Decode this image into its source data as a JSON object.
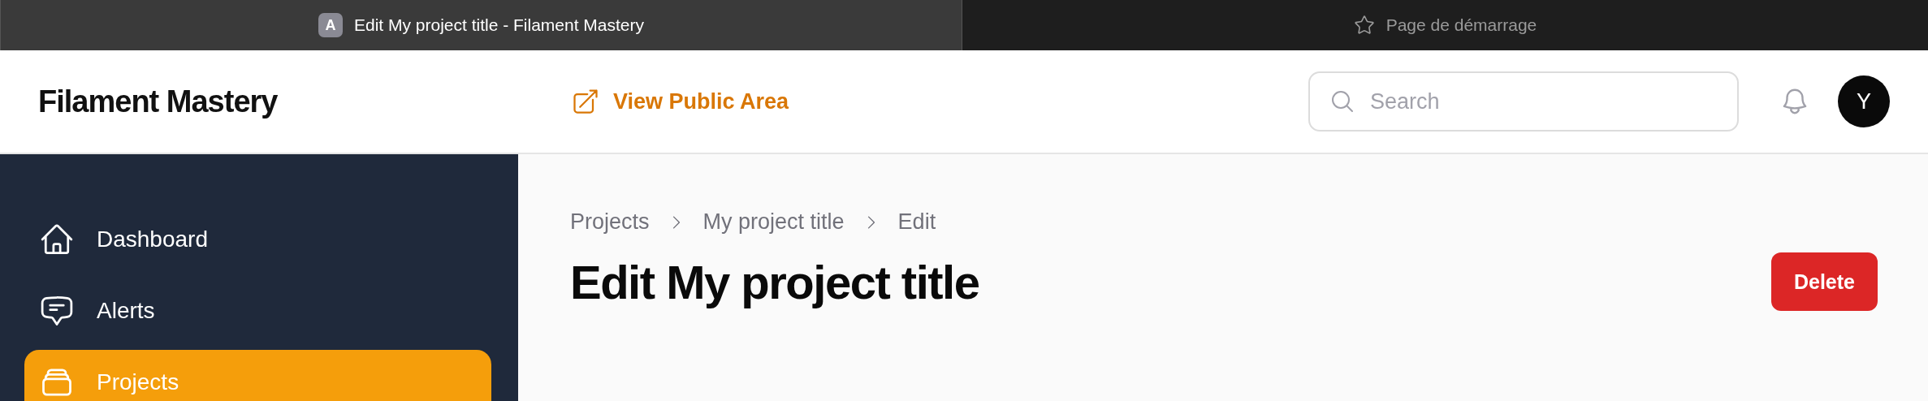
{
  "browser_tabs": [
    {
      "title": "Edit My project title - Filament Mastery",
      "favicon": "A",
      "selected": true
    },
    {
      "title": "Page de démarrage",
      "selected": false
    }
  ],
  "header": {
    "brand": "Filament Mastery",
    "public_link": "View Public Area",
    "search": {
      "placeholder": "Search"
    },
    "avatar": "Y"
  },
  "sidebar": {
    "items": [
      {
        "label": "Dashboard",
        "kind": "home",
        "selected": false
      },
      {
        "label": "Alerts",
        "kind": "chat",
        "selected": false
      },
      {
        "label": "Projects",
        "kind": "stack",
        "selected": true
      }
    ]
  },
  "breadcrumbs": [
    "Projects",
    "My project title",
    "Edit"
  ],
  "page": {
    "title": "Edit My project title",
    "actions": [
      "Delete"
    ]
  }
}
